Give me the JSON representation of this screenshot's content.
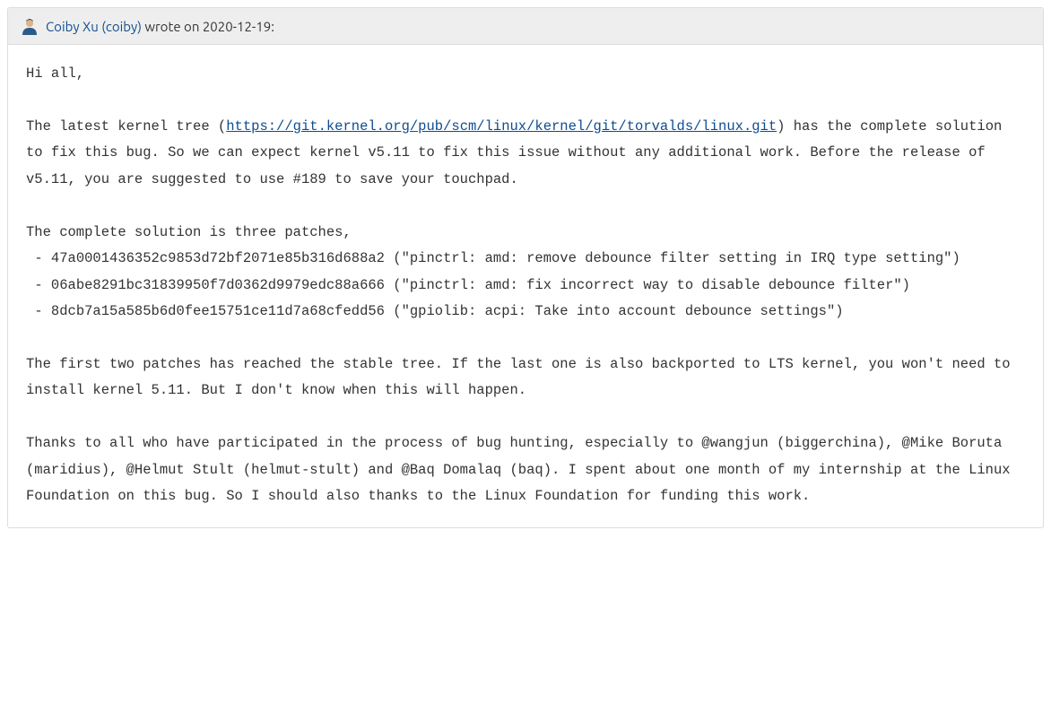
{
  "header": {
    "author_name": "Coiby Xu (coiby)",
    "wrote_on": " wrote on ",
    "date": "2020-12-19",
    "colon": ":"
  },
  "body": {
    "p1": "Hi all,",
    "p2a": "The latest kernel tree (",
    "p2_link_text": "https://git.kernel.org/pub/scm/linux/kernel/git/torvalds/linux.git",
    "p2b": ") has the complete solution to fix this bug. So we can expect kernel v5.11 to fix this issue without any additional work. Before the release of v5.11, you are suggested to use #189 to save your touchpad.",
    "p3": "The complete solution is three patches,\n - 47a0001436352c9853d72bf2071e85b316d688a2 (\"pinctrl: amd: remove debounce filter setting in IRQ type setting\")\n - 06abe8291bc31839950f7d0362d9979edc88a666 (\"pinctrl: amd: fix incorrect way to disable debounce filter\")\n - 8dcb7a15a585b6d0fee15751ce11d7a68cfedd56 (\"gpiolib: acpi: Take into account debounce settings\")",
    "p4": "The first two patches has reached the stable tree. If the last one is also backported to LTS kernel, you won't need to install kernel 5.11. But I don't know when this will happen.",
    "p5": "Thanks to all who have participated in the process of bug hunting, especially to @wangjun (biggerchina), @Mike Boruta (maridius), @Helmut Stult (helmut-stult) and @Baq Domalaq (baq). I spent about one month of my internship at the Linux Foundation on this bug. So I should also thanks to the Linux Foundation for funding this work."
  }
}
